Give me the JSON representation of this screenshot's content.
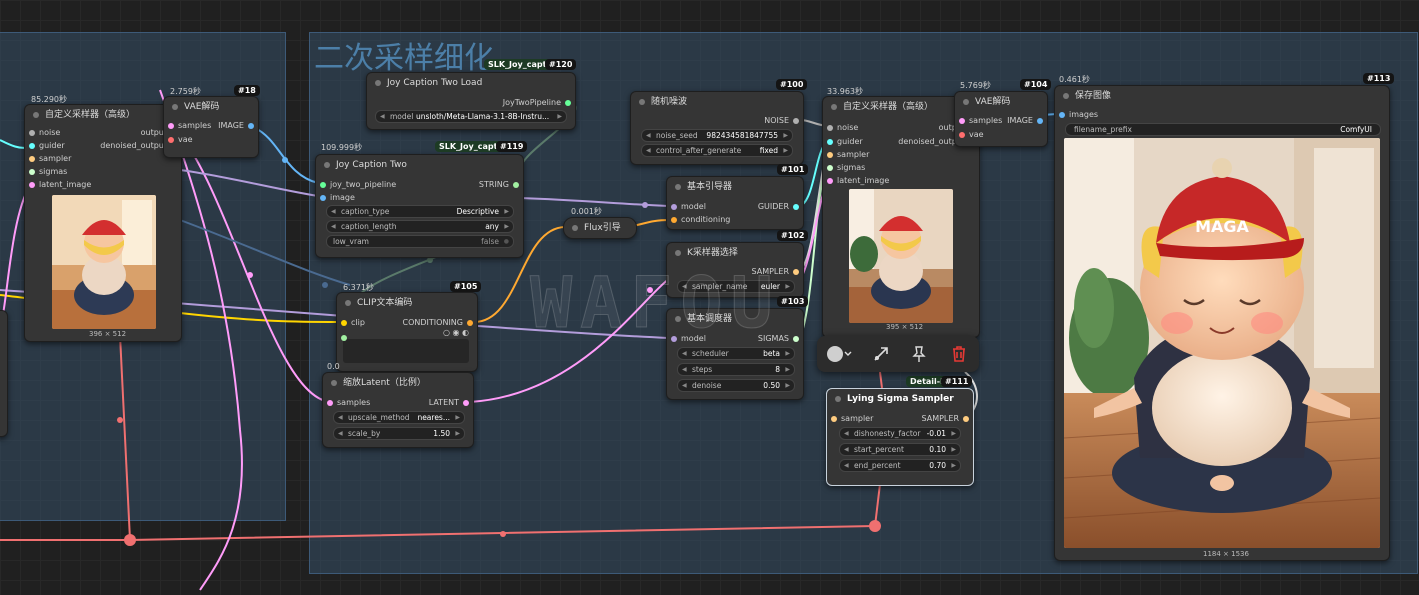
{
  "groups": {
    "refine_title": "二次采样细化"
  },
  "watermark": "WAFOU",
  "colors": {
    "model": "#b39ddb",
    "image": "#64b5f6",
    "latent": "#ff9cf9",
    "conditioning": "#ffa931",
    "clip": "#ffd500",
    "noise": "#b0b0b0",
    "guider": "#66ffff",
    "sampler": "#ffcc80",
    "sigmas": "#cdffcd",
    "vae": "#ff6e6e",
    "pipeline": "#66ff99",
    "string": "#a1f0a1"
  },
  "nodes": {
    "sampler_left": {
      "title": "自定义采样器（高级）",
      "timing": "85.290秒",
      "in": [
        "noise",
        "guider",
        "sampler",
        "sigmas",
        "latent_image"
      ],
      "out_output": "output",
      "out_denoised": "denoised_output",
      "dims": "396 × 512"
    },
    "vae_left": {
      "title": "VAE解码",
      "timing": "2.759秒",
      "badge": "#18",
      "in_samples": "samples",
      "in_vae": "vae",
      "out": "IMAGE"
    },
    "joy_load": {
      "title": "Joy Caption Two Load",
      "badge_slk": "SLK_Joy_caption",
      "badge": "#120",
      "out": "JoyTwoPipeline",
      "w_model_label": "model",
      "w_model_value": "unsloth/Meta-Llama-3.1-8B-Instru..."
    },
    "joy_two": {
      "title": "Joy Caption Two",
      "timing": "109.999秒",
      "badge_slk": "SLK_Joy_captio",
      "badge": "#119",
      "in_pipe": "joy_two_pipeline",
      "in_image": "image",
      "out": "STRING",
      "w1_label": "caption_type",
      "w1_value": "Descriptive",
      "w2_label": "caption_length",
      "w2_value": "any",
      "w3_label": "low_vram",
      "w3_value": "false"
    },
    "clip_encode": {
      "title": "CLIP文本编码",
      "timing": "6.371秒",
      "badge": "#105",
      "in": "clip",
      "out": "CONDITIONING"
    },
    "scale_latent": {
      "title": "缩放Latent（比例）",
      "timing": "0.0",
      "in": "samples",
      "out": "LATENT",
      "w1_label": "upscale_method",
      "w1_value": "neares...",
      "w2_label": "scale_by",
      "w2_value": "1.50"
    },
    "flux_guide": {
      "title": "Flux引导",
      "timing": "0.001秒"
    },
    "random_noise": {
      "title": "随机噪波",
      "badge": "#100",
      "out": "NOISE",
      "w1_label": "noise_seed",
      "w1_value": "982434581847755",
      "w2_label": "control_after_generate",
      "w2_value": "fixed"
    },
    "basic_guider": {
      "title": "基本引导器",
      "badge": "#101",
      "in_model": "model",
      "in_cond": "conditioning",
      "out": "GUIDER"
    },
    "k_sampler_select": {
      "title": "K采样器选择",
      "badge": "#102",
      "out": "SAMPLER",
      "w1_label": "sampler_name",
      "w1_value": "euler"
    },
    "basic_scheduler": {
      "title": "基本调度器",
      "badge": "#103",
      "in": "model",
      "out": "SIGMAS",
      "w1_label": "scheduler",
      "w1_value": "beta",
      "w2_label": "steps",
      "w2_value": "8",
      "w3_label": "denoise",
      "w3_value": "0.50"
    },
    "sampler_right": {
      "title": "自定义采样器（高级）",
      "timing": "33.963秒",
      "in": [
        "noise",
        "guider",
        "sampler",
        "sigmas",
        "latent_image"
      ],
      "out_output": "output",
      "out_denoised": "denoised_output",
      "dims": "395 × 512"
    },
    "vae_right": {
      "title": "VAE解码",
      "timing": "5.769秒",
      "badge": "#104",
      "in_samples": "samples",
      "in_vae": "vae",
      "out": "IMAGE"
    },
    "lying_sigma": {
      "title": "Lying Sigma Sampler",
      "badge_slk": "Detail-Da",
      "badge": "#111",
      "in": "sampler",
      "out": "SAMPLER",
      "w1_label": "dishonesty_factor",
      "w1_value": "-0.01",
      "w2_label": "start_percent",
      "w2_value": "0.10",
      "w3_label": "end_percent",
      "w3_value": "0.70"
    },
    "save_image": {
      "title": "保存图像",
      "timing": "0.461秒",
      "badge": "#113",
      "in": "images",
      "w1_label": "filename_prefix",
      "w1_value": "ComfyUI",
      "dims": "1184 × 1536"
    }
  },
  "image_content": {
    "cap_text": "MAGA"
  },
  "toolbar": {
    "icons": [
      "color-picker-icon",
      "chevron-down-icon",
      "bypass-icon",
      "pin-icon",
      "delete-icon"
    ],
    "delete_color": "#e53935"
  }
}
